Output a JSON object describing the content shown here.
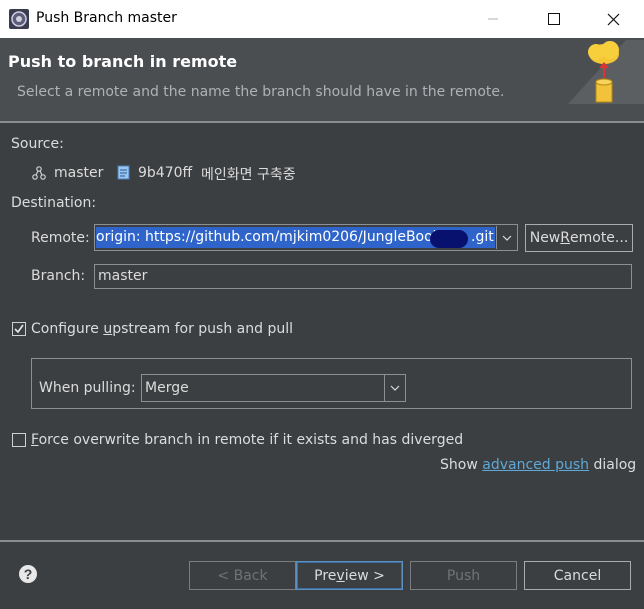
{
  "window": {
    "title": "Push Branch master"
  },
  "header": {
    "title": "Push to branch in remote",
    "description": "Select a remote and the name the branch should have in the remote."
  },
  "source": {
    "label": "Source:",
    "branch": "master",
    "commit_id": "9b470ff",
    "commit_message": "메인화면 구축중"
  },
  "destination": {
    "label": "Destination:",
    "remote_label": "Remote:",
    "remote_value": "origin: https://github.com/mjkim0206/JungleBook",
    "remote_value_suffix": ".git",
    "new_remote_label_pre": "New ",
    "new_remote_label_mn": "R",
    "new_remote_label_post": "emote...",
    "branch_label": "Branch:",
    "branch_value": "master"
  },
  "upstream": {
    "checkbox_pre": "Configure ",
    "checkbox_mn": "u",
    "checkbox_post": "pstream for push and pull",
    "checked": true,
    "when_pulling_label": "When pulling:",
    "when_pulling_value": "Merge"
  },
  "force": {
    "mn": "F",
    "label_post": "orce overwrite branch in remote if it exists and has diverged",
    "checked": false
  },
  "advanced": {
    "pre": "Show ",
    "link": "advanced push",
    "post": " dialog"
  },
  "footer": {
    "back_label": "< Back",
    "preview_pre": "Pre",
    "preview_mn": "v",
    "preview_post": "iew >",
    "push_label": "Push",
    "cancel_label": "Cancel"
  },
  "icons": {
    "app": "eclipse-icon",
    "help": "help-icon",
    "branch": "branch-icon",
    "commit": "commit-icon",
    "header": "push-cloud-icon"
  },
  "colors": {
    "background": "#3c3f41",
    "header_background": "#4b4e51",
    "selection": "#2f65ca",
    "link": "#5fa8d8"
  }
}
